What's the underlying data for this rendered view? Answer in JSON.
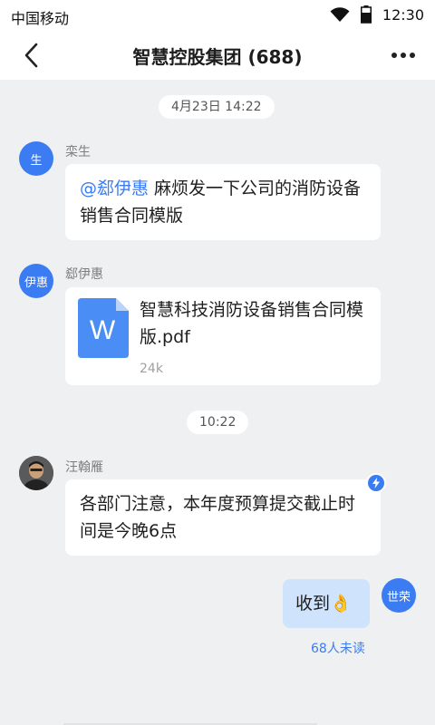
{
  "status": {
    "carrier": "中国移动",
    "time": "12:30"
  },
  "header": {
    "title": "智慧控股集团 (688)"
  },
  "messages": {
    "time1": "4月23日 14:22",
    "m1": {
      "avatar": "生",
      "sender": "栾生",
      "mention": "@郄伊惠",
      "text": " 麻烦发一下公司的消防设备销售合同模版"
    },
    "m2": {
      "avatar": "伊惠",
      "sender": "郄伊惠",
      "file_letter": "W",
      "file_name": "智慧科技消防设备销售合同模版.pdf",
      "file_size": "24k"
    },
    "time2": "10:22",
    "m3": {
      "sender": "汪翰雁",
      "text": "各部门注意，本年度预算提交截止时间是今晚6点"
    },
    "m4": {
      "avatar": "世荣",
      "text": "收到",
      "emoji": "👌",
      "unread": "68人未读"
    }
  },
  "colors": {
    "accent": "#3b7cf2",
    "self_bubble": "#cfe4fc",
    "background": "#eff0f2"
  }
}
